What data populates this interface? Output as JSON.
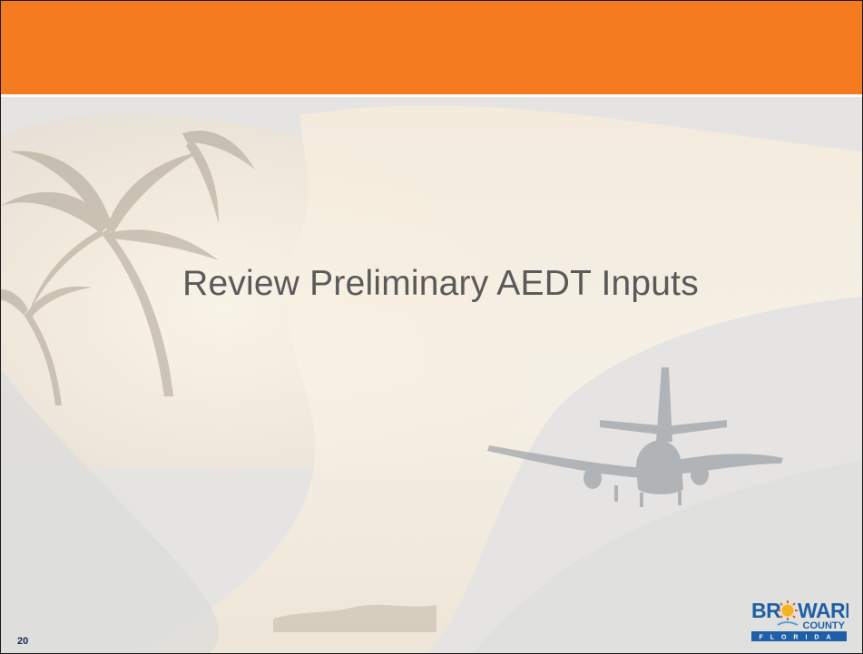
{
  "slide": {
    "title": "Review Preliminary AEDT Inputs",
    "page_number": "20"
  },
  "logo": {
    "word": "BROWARD",
    "county": "COUNTY",
    "state": "FLORIDA"
  },
  "colors": {
    "header": "#f47b20",
    "background": "#e6e6e6",
    "title_text": "#5a5a5a",
    "logo_blue": "#1f5fa8"
  },
  "icons": {
    "palm": "palm-tree-silhouette",
    "plane": "airplane-silhouette"
  }
}
